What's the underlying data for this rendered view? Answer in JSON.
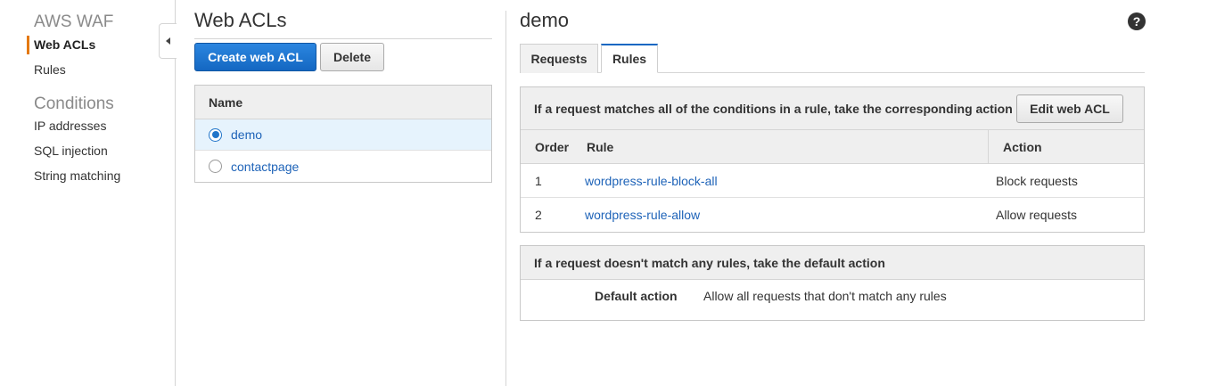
{
  "sidebar": {
    "title": "AWS WAF",
    "items": [
      {
        "label": "Web ACLs",
        "active": true
      },
      {
        "label": "Rules",
        "active": false
      }
    ],
    "conditions_title": "Conditions",
    "conditions": [
      {
        "label": "IP addresses"
      },
      {
        "label": "SQL injection"
      },
      {
        "label": "String matching"
      }
    ]
  },
  "acls": {
    "title": "Web ACLs",
    "create_label": "Create web ACL",
    "delete_label": "Delete",
    "column_name": "Name",
    "rows": [
      {
        "name": "demo",
        "selected": true
      },
      {
        "name": "contactpage",
        "selected": false
      }
    ]
  },
  "detail": {
    "title": "demo",
    "help_glyph": "?",
    "tabs": [
      {
        "label": "Requests",
        "active": false
      },
      {
        "label": "Rules",
        "active": true
      }
    ],
    "rules_box": {
      "heading": "If a request matches all of the conditions in a rule, take the corresponding action",
      "edit_label": "Edit web ACL",
      "columns": {
        "order": "Order",
        "rule": "Rule",
        "action": "Action"
      },
      "rows": [
        {
          "order": "1",
          "rule": "wordpress-rule-block-all",
          "action": "Block requests"
        },
        {
          "order": "2",
          "rule": "wordpress-rule-allow",
          "action": "Allow requests"
        }
      ]
    },
    "default_box": {
      "heading": "If a request doesn't match any rules, take the default action",
      "label": "Default action",
      "value": "Allow all requests that don't match any rules"
    }
  },
  "colors": {
    "accent": "#e47911",
    "primary": "#1467c2",
    "link": "#1e63b8",
    "selected_row": "#e6f3fd"
  }
}
